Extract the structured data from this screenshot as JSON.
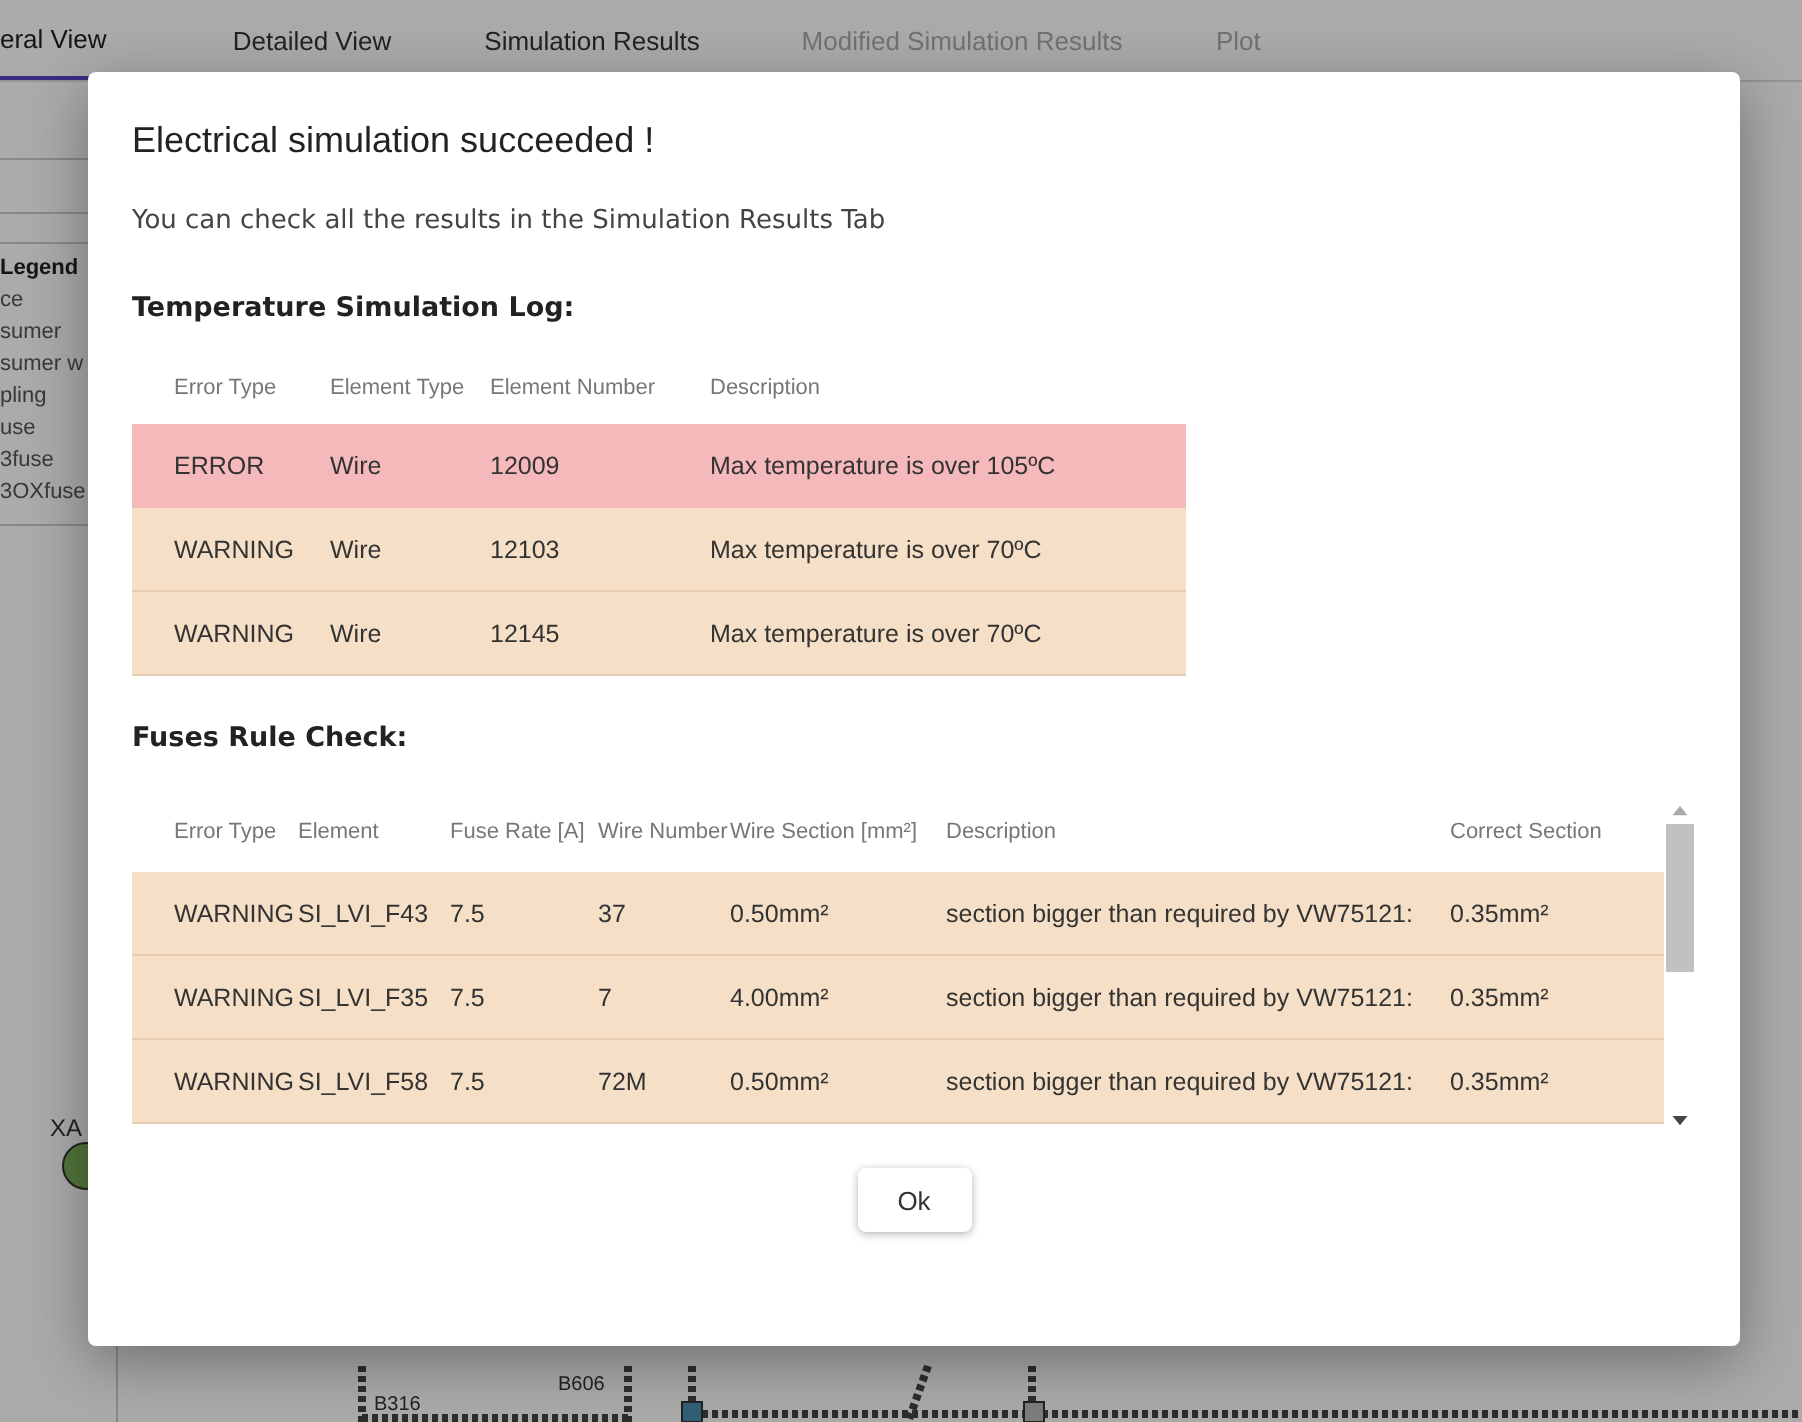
{
  "tabs": [
    {
      "label": "eral View",
      "selected": true,
      "disabled": false
    },
    {
      "label": "Detailed View",
      "selected": false,
      "disabled": false
    },
    {
      "label": "Simulation Results",
      "selected": false,
      "disabled": false
    },
    {
      "label": "Modified Simulation Results",
      "selected": false,
      "disabled": true
    },
    {
      "label": "Plot",
      "selected": false,
      "disabled": true
    }
  ],
  "legend": {
    "title": "Legend",
    "items": [
      "ce",
      "sumer",
      "sumer w",
      "pling",
      "use",
      "3fuse",
      "3OXfuse"
    ]
  },
  "canvas": {
    "labels": [
      "XA",
      "B316",
      "B606"
    ]
  },
  "dialog": {
    "title": "Electrical simulation succeeded !",
    "message": "You can check all the results in the Simulation Results Tab",
    "temperature": {
      "heading": "Temperature Simulation Log:",
      "columns": [
        "Error Type",
        "Element Type",
        "Element Number",
        "Description"
      ],
      "rows": [
        {
          "kind": "error",
          "cells": [
            "ERROR",
            "Wire",
            "12009",
            "Max temperature is over 105ºC"
          ]
        },
        {
          "kind": "warning",
          "cells": [
            "WARNING",
            "Wire",
            "12103",
            "Max temperature is over 70ºC"
          ]
        },
        {
          "kind": "warning",
          "cells": [
            "WARNING",
            "Wire",
            "12145",
            "Max temperature is over 70ºC"
          ]
        }
      ]
    },
    "fuses": {
      "heading": "Fuses Rule Check:",
      "columns": [
        "Error Type",
        "Element",
        "Fuse Rate [A]",
        "Wire Number",
        "Wire Section [mm²]",
        "Description",
        "Correct Section"
      ],
      "rows": [
        {
          "kind": "warning",
          "cells": [
            "WARNING",
            "SI_LVI_F43",
            "7.5",
            "37",
            "0.50mm²",
            "section bigger than required by VW75121:",
            "0.35mm²"
          ]
        },
        {
          "kind": "warning",
          "cells": [
            "WARNING",
            "SI_LVI_F35",
            "7.5",
            "7",
            "4.00mm²",
            "section bigger than required by VW75121:",
            "0.35mm²"
          ]
        },
        {
          "kind": "warning",
          "cells": [
            "WARNING",
            "SI_LVI_F58",
            "7.5",
            "72M",
            "0.50mm²",
            "section bigger than required by VW75121:",
            "0.35mm²"
          ]
        }
      ]
    },
    "ok_button": "Ok"
  }
}
